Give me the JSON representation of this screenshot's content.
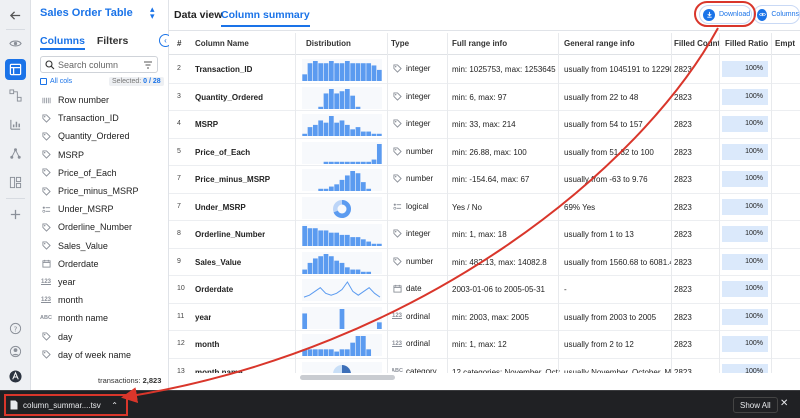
{
  "app": {
    "title": "Sales Order Table",
    "title_caret": "⌃⌄"
  },
  "sidebar": {
    "tabs": [
      {
        "label": "Columns",
        "active": true
      },
      {
        "label": "Filters",
        "active": false
      }
    ],
    "collapse_glyph": "‹",
    "search": {
      "placeholder": "Search column",
      "value": ""
    },
    "all_cols_label": "All cols",
    "selected_prefix": "Selected: ",
    "selected_count": "0 / 28",
    "columns": [
      {
        "name": "Row number",
        "icon": "row-number-icon"
      },
      {
        "name": "Transaction_ID",
        "icon": "tag-icon"
      },
      {
        "name": "Quantity_Ordered",
        "icon": "tag-icon"
      },
      {
        "name": "MSRP",
        "icon": "tag-icon"
      },
      {
        "name": "Price_of_Each",
        "icon": "tag-icon"
      },
      {
        "name": "Price_minus_MSRP",
        "icon": "tag-icon"
      },
      {
        "name": "Under_MSRP",
        "icon": "logical-icon"
      },
      {
        "name": "Orderline_Number",
        "icon": "tag-icon"
      },
      {
        "name": "Sales_Value",
        "icon": "tag-icon"
      },
      {
        "name": "Orderdate",
        "icon": "calendar-icon"
      },
      {
        "name": "year",
        "icon": "ordinal-icon"
      },
      {
        "name": "month",
        "icon": "ordinal-icon"
      },
      {
        "name": "month name",
        "icon": "category-icon"
      },
      {
        "name": "day",
        "icon": "tag-icon"
      },
      {
        "name": "day of week name",
        "icon": "tag-icon"
      }
    ],
    "type_glyphs": {
      "ordinal": "123",
      "category": "ABC"
    },
    "transactions_label": "transactions: ",
    "transactions_count": "2,823"
  },
  "topbar": {
    "tabs": [
      {
        "label": "Data view",
        "active": false
      },
      {
        "label": "Column summary",
        "active": true
      }
    ],
    "download_label": "Download",
    "columns_label": "Columns"
  },
  "table": {
    "headers": [
      "#",
      "Column Name",
      "Distribution",
      "Type",
      "Full range info",
      "General range info",
      "Filled Count",
      "Filled Ratio",
      "Empt"
    ],
    "rows": [
      {
        "num": "2",
        "name": "Transaction_ID",
        "type": "integer",
        "type_icon": "tag-icon",
        "full": "min: 1025753, max: 1253645",
        "general": "usually from 1045191 to 12290",
        "filled": "2823",
        "ratio": "100%",
        "dist": [
          3,
          8,
          9,
          8,
          8,
          9,
          8,
          8,
          9,
          8,
          8,
          8,
          8,
          7,
          5
        ],
        "dist_kind": "bar"
      },
      {
        "num": "3",
        "name": "Quantity_Ordered",
        "type": "integer",
        "type_icon": "tag-icon",
        "full": "min: 6, max: 97",
        "general": "usually from 22 to 48",
        "filled": "2823",
        "ratio": "100%",
        "dist": [
          0,
          0,
          0,
          1,
          7,
          9,
          7,
          8,
          9,
          6,
          1,
          0,
          0,
          0,
          0
        ],
        "dist_kind": "bar"
      },
      {
        "num": "4",
        "name": "MSRP",
        "type": "integer",
        "type_icon": "tag-icon",
        "full": "min: 33, max: 214",
        "general": "usually from 54 to 157",
        "filled": "2823",
        "ratio": "100%",
        "dist": [
          1,
          4,
          5,
          7,
          6,
          9,
          6,
          7,
          5,
          3,
          4,
          2,
          2,
          1,
          1
        ],
        "dist_kind": "bar"
      },
      {
        "num": "5",
        "name": "Price_of_Each",
        "type": "number",
        "type_icon": "tag-icon",
        "full": "min: 26.88, max: 100",
        "general": "usually from 51.32 to 100",
        "filled": "2823",
        "ratio": "100%",
        "dist": [
          0,
          0,
          0,
          0,
          1,
          1,
          1,
          1,
          1,
          1,
          1,
          1,
          1,
          2,
          9
        ],
        "dist_kind": "bar"
      },
      {
        "num": "7",
        "name": "Price_minus_MSRP",
        "type": "number",
        "type_icon": "tag-icon",
        "full": "min: -154.64, max: 67",
        "general": "usually from -63 to 9.76",
        "filled": "2823",
        "ratio": "100%",
        "dist": [
          0,
          0,
          0,
          1,
          1,
          2,
          3,
          5,
          7,
          9,
          8,
          4,
          1,
          0,
          0
        ],
        "dist_kind": "bar"
      },
      {
        "num": "7",
        "name": "Under_MSRP",
        "type": "logical",
        "type_icon": "logical-icon",
        "full": "Yes / No",
        "general": "69% Yes",
        "filled": "2823",
        "ratio": "100%",
        "dist": [
          69
        ],
        "dist_kind": "donut"
      },
      {
        "num": "8",
        "name": "Orderline_Number",
        "type": "integer",
        "type_icon": "tag-icon",
        "full": "min: 1, max: 18",
        "general": "usually from 1 to 13",
        "filled": "2823",
        "ratio": "100%",
        "dist": [
          9,
          8,
          8,
          7,
          7,
          6,
          6,
          5,
          5,
          4,
          4,
          3,
          2,
          1,
          1
        ],
        "dist_kind": "bar"
      },
      {
        "num": "9",
        "name": "Sales_Value",
        "type": "number",
        "type_icon": "tag-icon",
        "full": "min: 482.13, max: 14082.8",
        "general": "usually from 1560.68 to 6081.4",
        "filled": "2823",
        "ratio": "100%",
        "dist": [
          2,
          5,
          7,
          8,
          9,
          8,
          6,
          5,
          3,
          2,
          2,
          1,
          1,
          0,
          0
        ],
        "dist_kind": "bar"
      },
      {
        "num": "10",
        "name": "Orderdate",
        "type": "date",
        "type_icon": "calendar-icon",
        "full": "2003-01-06 to 2005-05-31",
        "general": "-",
        "filled": "2823",
        "ratio": "100%",
        "dist": [
          1,
          2,
          4,
          6,
          3,
          2,
          3,
          5,
          9,
          4,
          2,
          4,
          6,
          3,
          1
        ],
        "dist_kind": "line"
      },
      {
        "num": "11",
        "name": "year",
        "type": "ordinal",
        "type_icon": "ordinal-icon",
        "full": "min: 2003, max: 2005",
        "general": "usually from 2003 to 2005",
        "filled": "2823",
        "ratio": "100%",
        "dist": [
          7,
          0,
          0,
          0,
          0,
          0,
          0,
          9,
          0,
          0,
          0,
          0,
          0,
          0,
          3
        ],
        "dist_kind": "bar"
      },
      {
        "num": "12",
        "name": "month",
        "type": "ordinal",
        "type_icon": "ordinal-icon",
        "full": "min: 1, max: 12",
        "general": "usually from 2 to 12",
        "filled": "2823",
        "ratio": "100%",
        "dist": [
          3,
          3,
          3,
          3,
          3,
          3,
          2,
          3,
          3,
          6,
          9,
          9,
          3,
          0,
          0
        ],
        "dist_kind": "bar"
      },
      {
        "num": "13",
        "name": "month name",
        "type": "category",
        "type_icon": "category-icon",
        "full": "12 categories: November, Octob",
        "general": "usually November, October, May,",
        "filled": "2823",
        "ratio": "100%",
        "dist": [
          30
        ],
        "dist_kind": "pie"
      }
    ]
  },
  "download_bar": {
    "filename": "column_summar....tsv",
    "show_all": "Show All",
    "close_glyph": "✕",
    "chevron_glyph": "⌃"
  },
  "colors": {
    "accent": "#1a73e8",
    "bar": "#5b9bf0",
    "highlight": "#d9362b",
    "ratio_bg": "#dbe9fb"
  }
}
